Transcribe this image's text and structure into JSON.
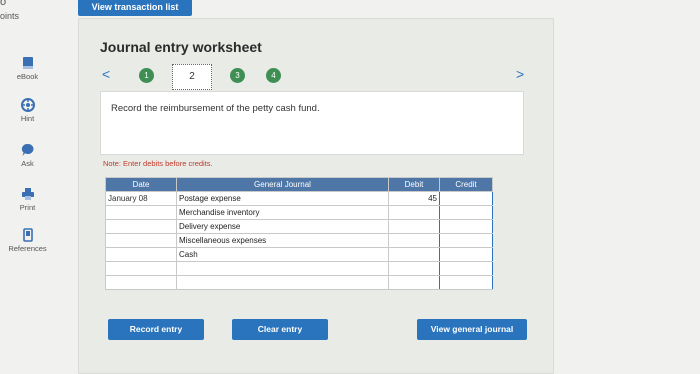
{
  "corner": {
    "top": "o",
    "label": "oints"
  },
  "sidebar": {
    "items": [
      {
        "label": "eBook",
        "icon": "book-icon"
      },
      {
        "label": "Hint",
        "icon": "hint-icon"
      },
      {
        "label": "Ask",
        "icon": "ask-icon"
      },
      {
        "label": "Print",
        "icon": "print-icon"
      },
      {
        "label": "References",
        "icon": "references-icon"
      }
    ]
  },
  "header": {
    "view_transaction_list": "View transaction list"
  },
  "worksheet": {
    "title": "Journal entry worksheet",
    "nav": {
      "prev": "<",
      "next": ">"
    },
    "steps": [
      "1",
      "2",
      "3",
      "4"
    ],
    "current_step": "2",
    "instruction": "Record the reimbursement of the petty cash fund.",
    "note": "Note: Enter debits before credits."
  },
  "journal": {
    "headers": {
      "date": "Date",
      "account": "General Journal",
      "debit": "Debit",
      "credit": "Credit"
    },
    "rows": [
      {
        "date": "January 08",
        "account": "Postage expense",
        "debit": "45",
        "credit": ""
      },
      {
        "date": "",
        "account": "Merchandise inventory",
        "debit": "",
        "credit": ""
      },
      {
        "date": "",
        "account": "Delivery expense",
        "debit": "",
        "credit": ""
      },
      {
        "date": "",
        "account": "Miscellaneous expenses",
        "debit": "",
        "credit": ""
      },
      {
        "date": "",
        "account": "Cash",
        "debit": "",
        "credit": ""
      },
      {
        "date": "",
        "account": "",
        "debit": "",
        "credit": ""
      },
      {
        "date": "",
        "account": "",
        "debit": "",
        "credit": ""
      }
    ]
  },
  "buttons": {
    "record": "Record entry",
    "clear": "Clear entry",
    "view_journal": "View general journal"
  },
  "colors": {
    "accent": "#2a74bd",
    "step_done": "#3f8f55",
    "header_bg": "#4e76a6",
    "note": "#c0392b"
  }
}
